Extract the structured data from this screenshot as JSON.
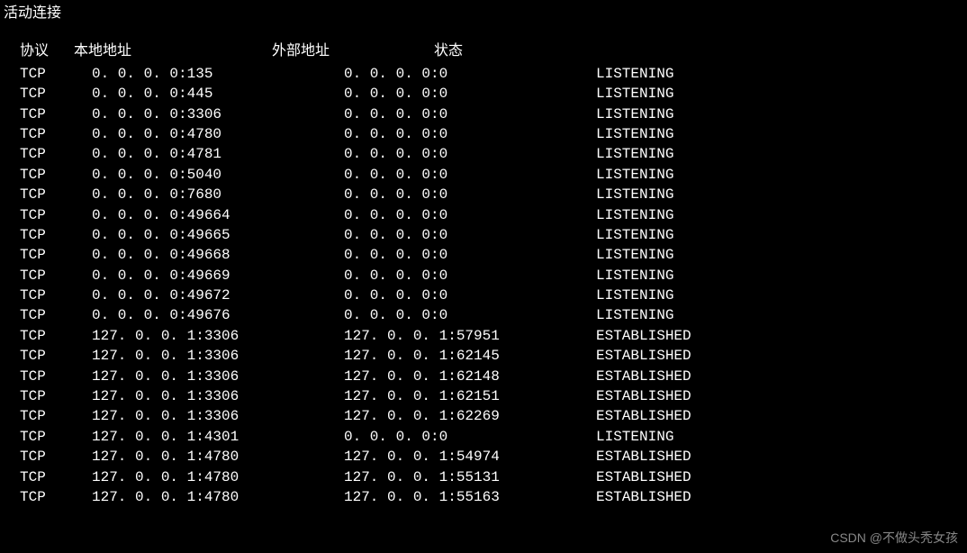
{
  "title": "活动连接",
  "headers": {
    "protocol": "协议",
    "local": "本地地址",
    "foreign": "外部地址",
    "state": "状态"
  },
  "rows": [
    {
      "proto": "TCP",
      "local": "0.0.0.0:135",
      "foreign": "0.0.0.0:0",
      "state": "LISTENING"
    },
    {
      "proto": "TCP",
      "local": "0.0.0.0:445",
      "foreign": "0.0.0.0:0",
      "state": "LISTENING"
    },
    {
      "proto": "TCP",
      "local": "0.0.0.0:3306",
      "foreign": "0.0.0.0:0",
      "state": "LISTENING"
    },
    {
      "proto": "TCP",
      "local": "0.0.0.0:4780",
      "foreign": "0.0.0.0:0",
      "state": "LISTENING"
    },
    {
      "proto": "TCP",
      "local": "0.0.0.0:4781",
      "foreign": "0.0.0.0:0",
      "state": "LISTENING"
    },
    {
      "proto": "TCP",
      "local": "0.0.0.0:5040",
      "foreign": "0.0.0.0:0",
      "state": "LISTENING"
    },
    {
      "proto": "TCP",
      "local": "0.0.0.0:7680",
      "foreign": "0.0.0.0:0",
      "state": "LISTENING"
    },
    {
      "proto": "TCP",
      "local": "0.0.0.0:49664",
      "foreign": "0.0.0.0:0",
      "state": "LISTENING"
    },
    {
      "proto": "TCP",
      "local": "0.0.0.0:49665",
      "foreign": "0.0.0.0:0",
      "state": "LISTENING"
    },
    {
      "proto": "TCP",
      "local": "0.0.0.0:49668",
      "foreign": "0.0.0.0:0",
      "state": "LISTENING"
    },
    {
      "proto": "TCP",
      "local": "0.0.0.0:49669",
      "foreign": "0.0.0.0:0",
      "state": "LISTENING"
    },
    {
      "proto": "TCP",
      "local": "0.0.0.0:49672",
      "foreign": "0.0.0.0:0",
      "state": "LISTENING"
    },
    {
      "proto": "TCP",
      "local": "0.0.0.0:49676",
      "foreign": "0.0.0.0:0",
      "state": "LISTENING"
    },
    {
      "proto": "TCP",
      "local": "127.0.0.1:3306",
      "foreign": "127.0.0.1:57951",
      "state": "ESTABLISHED"
    },
    {
      "proto": "TCP",
      "local": "127.0.0.1:3306",
      "foreign": "127.0.0.1:62145",
      "state": "ESTABLISHED"
    },
    {
      "proto": "TCP",
      "local": "127.0.0.1:3306",
      "foreign": "127.0.0.1:62148",
      "state": "ESTABLISHED"
    },
    {
      "proto": "TCP",
      "local": "127.0.0.1:3306",
      "foreign": "127.0.0.1:62151",
      "state": "ESTABLISHED"
    },
    {
      "proto": "TCP",
      "local": "127.0.0.1:3306",
      "foreign": "127.0.0.1:62269",
      "state": "ESTABLISHED"
    },
    {
      "proto": "TCP",
      "local": "127.0.0.1:4301",
      "foreign": "0.0.0.0:0",
      "state": "LISTENING"
    },
    {
      "proto": "TCP",
      "local": "127.0.0.1:4780",
      "foreign": "127.0.0.1:54974",
      "state": "ESTABLISHED"
    },
    {
      "proto": "TCP",
      "local": "127.0.0.1:4780",
      "foreign": "127.0.0.1:55131",
      "state": "ESTABLISHED"
    },
    {
      "proto": "TCP",
      "local": "127.0.0.1:4780",
      "foreign": "127.0.0.1:55163",
      "state": "ESTABLISHED"
    }
  ],
  "watermark": "CSDN @不做头秃女孩"
}
